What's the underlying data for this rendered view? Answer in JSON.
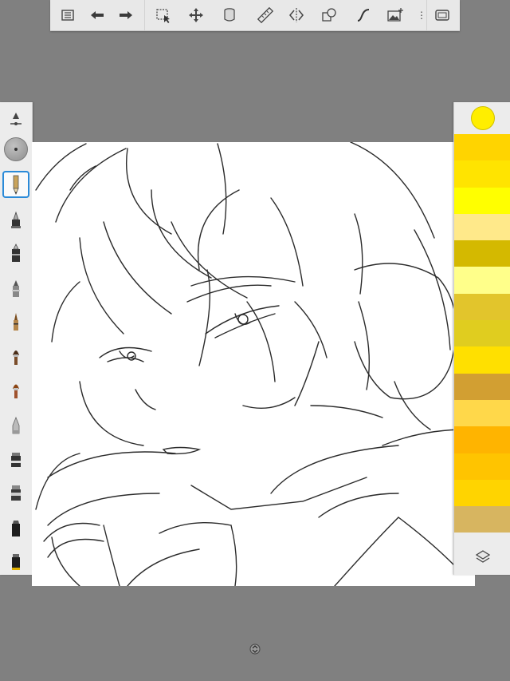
{
  "toolbar": {
    "items": [
      {
        "name": "menu-list-icon"
      },
      {
        "name": "undo-icon"
      },
      {
        "name": "redo-icon"
      },
      {
        "name": "selection-icon"
      },
      {
        "name": "transform-icon"
      },
      {
        "name": "fill-bucket-icon"
      },
      {
        "name": "ruler-icon"
      },
      {
        "name": "symmetry-icon"
      },
      {
        "name": "shapes-icon"
      },
      {
        "name": "curve-icon"
      },
      {
        "name": "add-image-icon"
      },
      {
        "name": "fullscreen-icon"
      }
    ]
  },
  "brushes": [
    "brush-size-opacity-icon",
    "brush-size-puck",
    "pencil-icon",
    "inkpen-icon",
    "technical-pen-icon",
    "marker-icon",
    "ballpoint-pen-icon",
    "paintbrush-icon",
    "watercolor-brush-icon",
    "airbrush-icon",
    "smudge-icon",
    "eraser-icon",
    "chisel-marker-icon",
    "flat-brush-icon"
  ],
  "colors": {
    "current": "#ffee00",
    "swatches": [
      "#ffd400",
      "#ffe400",
      "#ffff00",
      "#ffe98a",
      "#d4b900",
      "#ffff8a",
      "#e2c52c",
      "#e0cd1f",
      "#ffe000",
      "#d29f32",
      "#ffd84a",
      "#ffb400",
      "#ffc400",
      "#ffd400",
      "#d7b560"
    ]
  },
  "canvas": {
    "background": "#ffffff",
    "stroke": "#2b2b2b"
  }
}
